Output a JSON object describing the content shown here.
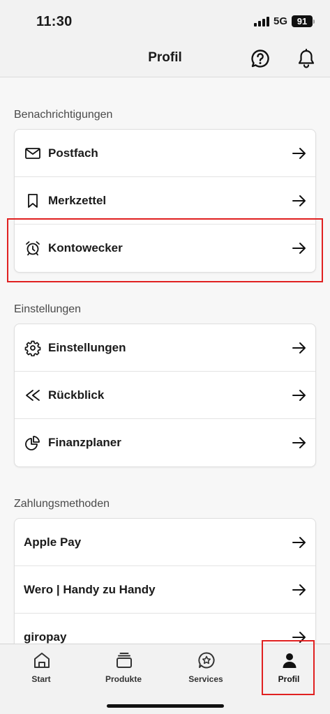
{
  "status_bar": {
    "time": "11:30",
    "network": "5G",
    "battery": "91"
  },
  "header": {
    "title": "Profil",
    "help_icon": "help-bubble-icon",
    "notifications_icon": "bell-icon"
  },
  "sections": {
    "notifications": {
      "title": "Benachrichtigungen",
      "items": [
        {
          "label": "Postfach",
          "icon": "mail-icon"
        },
        {
          "label": "Merkzettel",
          "icon": "bookmark-icon"
        },
        {
          "label": "Kontowecker",
          "icon": "alarm-clock-icon",
          "highlighted": true
        }
      ]
    },
    "settings": {
      "title": "Einstellungen",
      "items": [
        {
          "label": "Einstellungen",
          "icon": "gear-icon"
        },
        {
          "label": "Rückblick",
          "icon": "rewind-icon"
        },
        {
          "label": "Finanzplaner",
          "icon": "pie-chart-icon"
        }
      ]
    },
    "payment": {
      "title": "Zahlungsmethoden",
      "items": [
        {
          "label": "Apple Pay"
        },
        {
          "label": "Wero | Handy zu Handy"
        },
        {
          "label": "giropay"
        }
      ]
    }
  },
  "tabbar": {
    "items": [
      {
        "label": "Start",
        "icon": "home-icon"
      },
      {
        "label": "Produkte",
        "icon": "stack-icon"
      },
      {
        "label": "Services",
        "icon": "services-star-icon"
      },
      {
        "label": "Profil",
        "icon": "person-icon",
        "active": true,
        "highlighted": true
      }
    ]
  },
  "colors": {
    "highlight": "#e02020",
    "text": "#1a1a1a",
    "background": "#f7f7f7"
  }
}
